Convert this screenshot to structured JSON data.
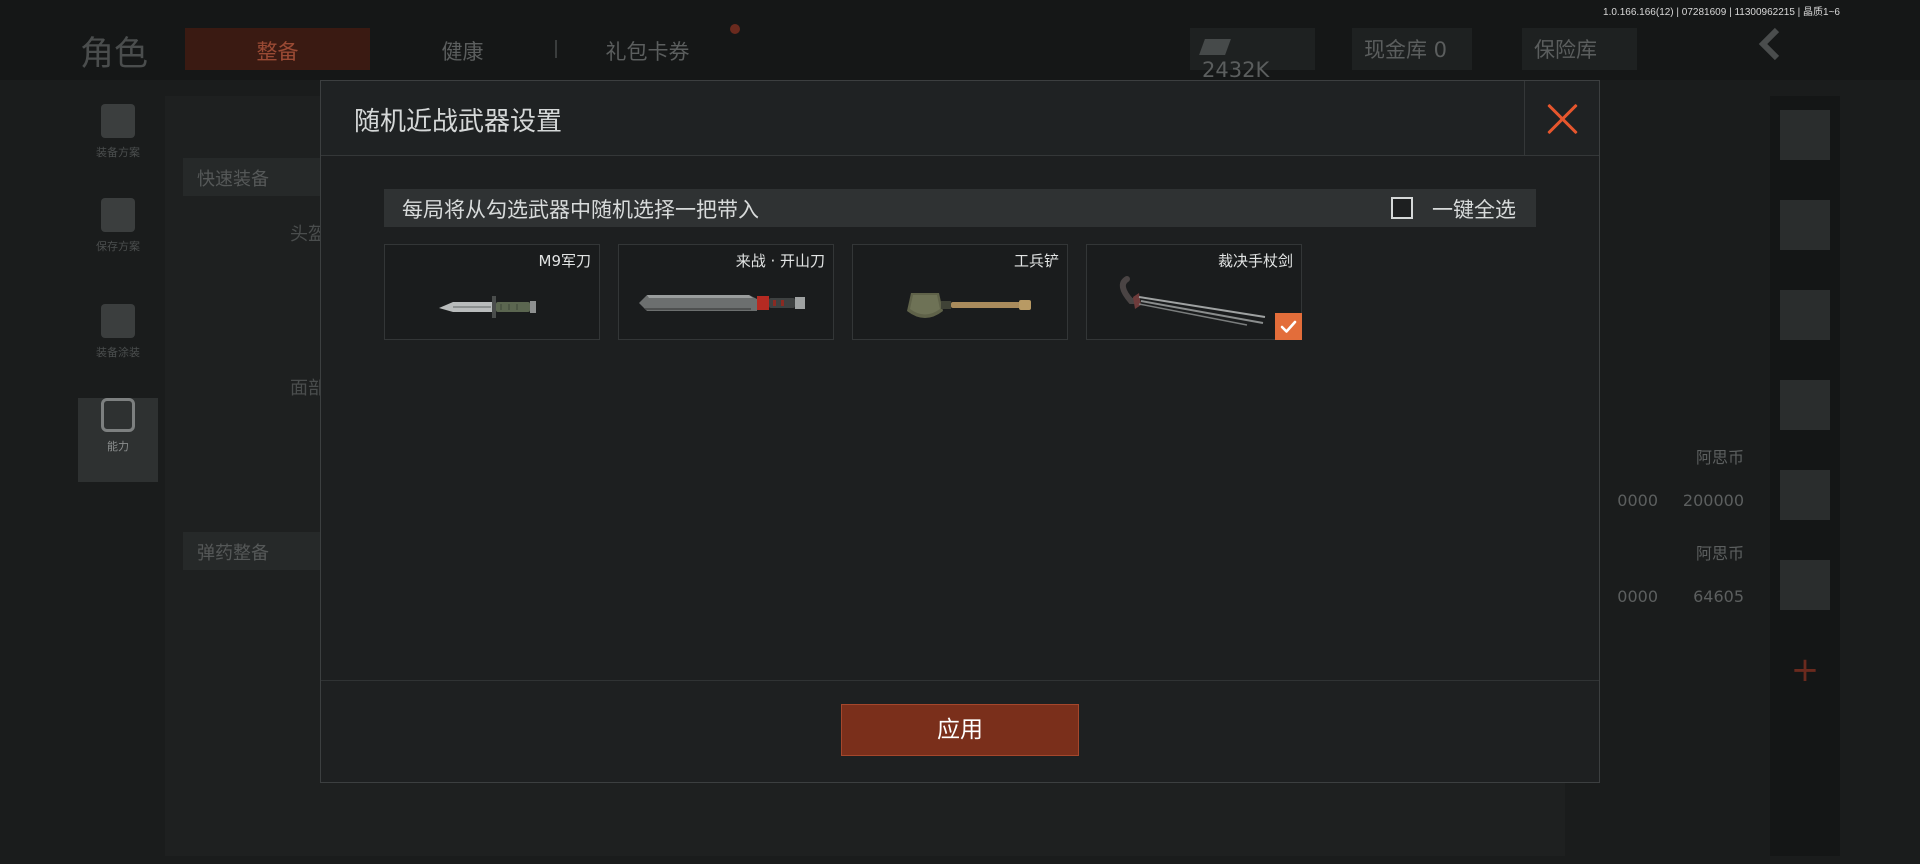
{
  "version_text": "1.0.166.166(12) | 07281609 | 11300962215 | 晶质1~6",
  "background": {
    "title": "角色",
    "tabs": [
      "整备",
      "健康",
      "礼包卡券"
    ],
    "money": "2432K",
    "cash_vault": "现金库 0",
    "insurance": "保险库",
    "left_nav": [
      "装备方案",
      "保存方案",
      "装备涂装",
      "能力"
    ],
    "chips": [
      "快速装备",
      "弹药整备"
    ],
    "slot_labels": [
      "头盔",
      "面部"
    ],
    "cards": [
      {
        "label": "阿思币",
        "value": "200000"
      },
      {
        "label": "阿思币",
        "value": "64605"
      }
    ],
    "partial_values": [
      "0000",
      "0000"
    ]
  },
  "modal": {
    "title": "随机近战武器设置",
    "notice": "每局将从勾选武器中随机选择一把带入",
    "select_all_label": "一键全选",
    "select_all_checked": false,
    "apply_label": "应用",
    "weapons": [
      {
        "name": "M9军刀",
        "icon": "knife-icon",
        "checked": false
      },
      {
        "name": "来战 · 开山刀",
        "icon": "machete-icon",
        "checked": false
      },
      {
        "name": "工兵铲",
        "icon": "shovel-icon",
        "checked": false
      },
      {
        "name": "裁决手杖剑",
        "icon": "cane-sword-icon",
        "checked": true
      }
    ]
  },
  "colors": {
    "accent": "#e6562d",
    "check": "#e36d3a",
    "apply": "#7a2f1b"
  }
}
